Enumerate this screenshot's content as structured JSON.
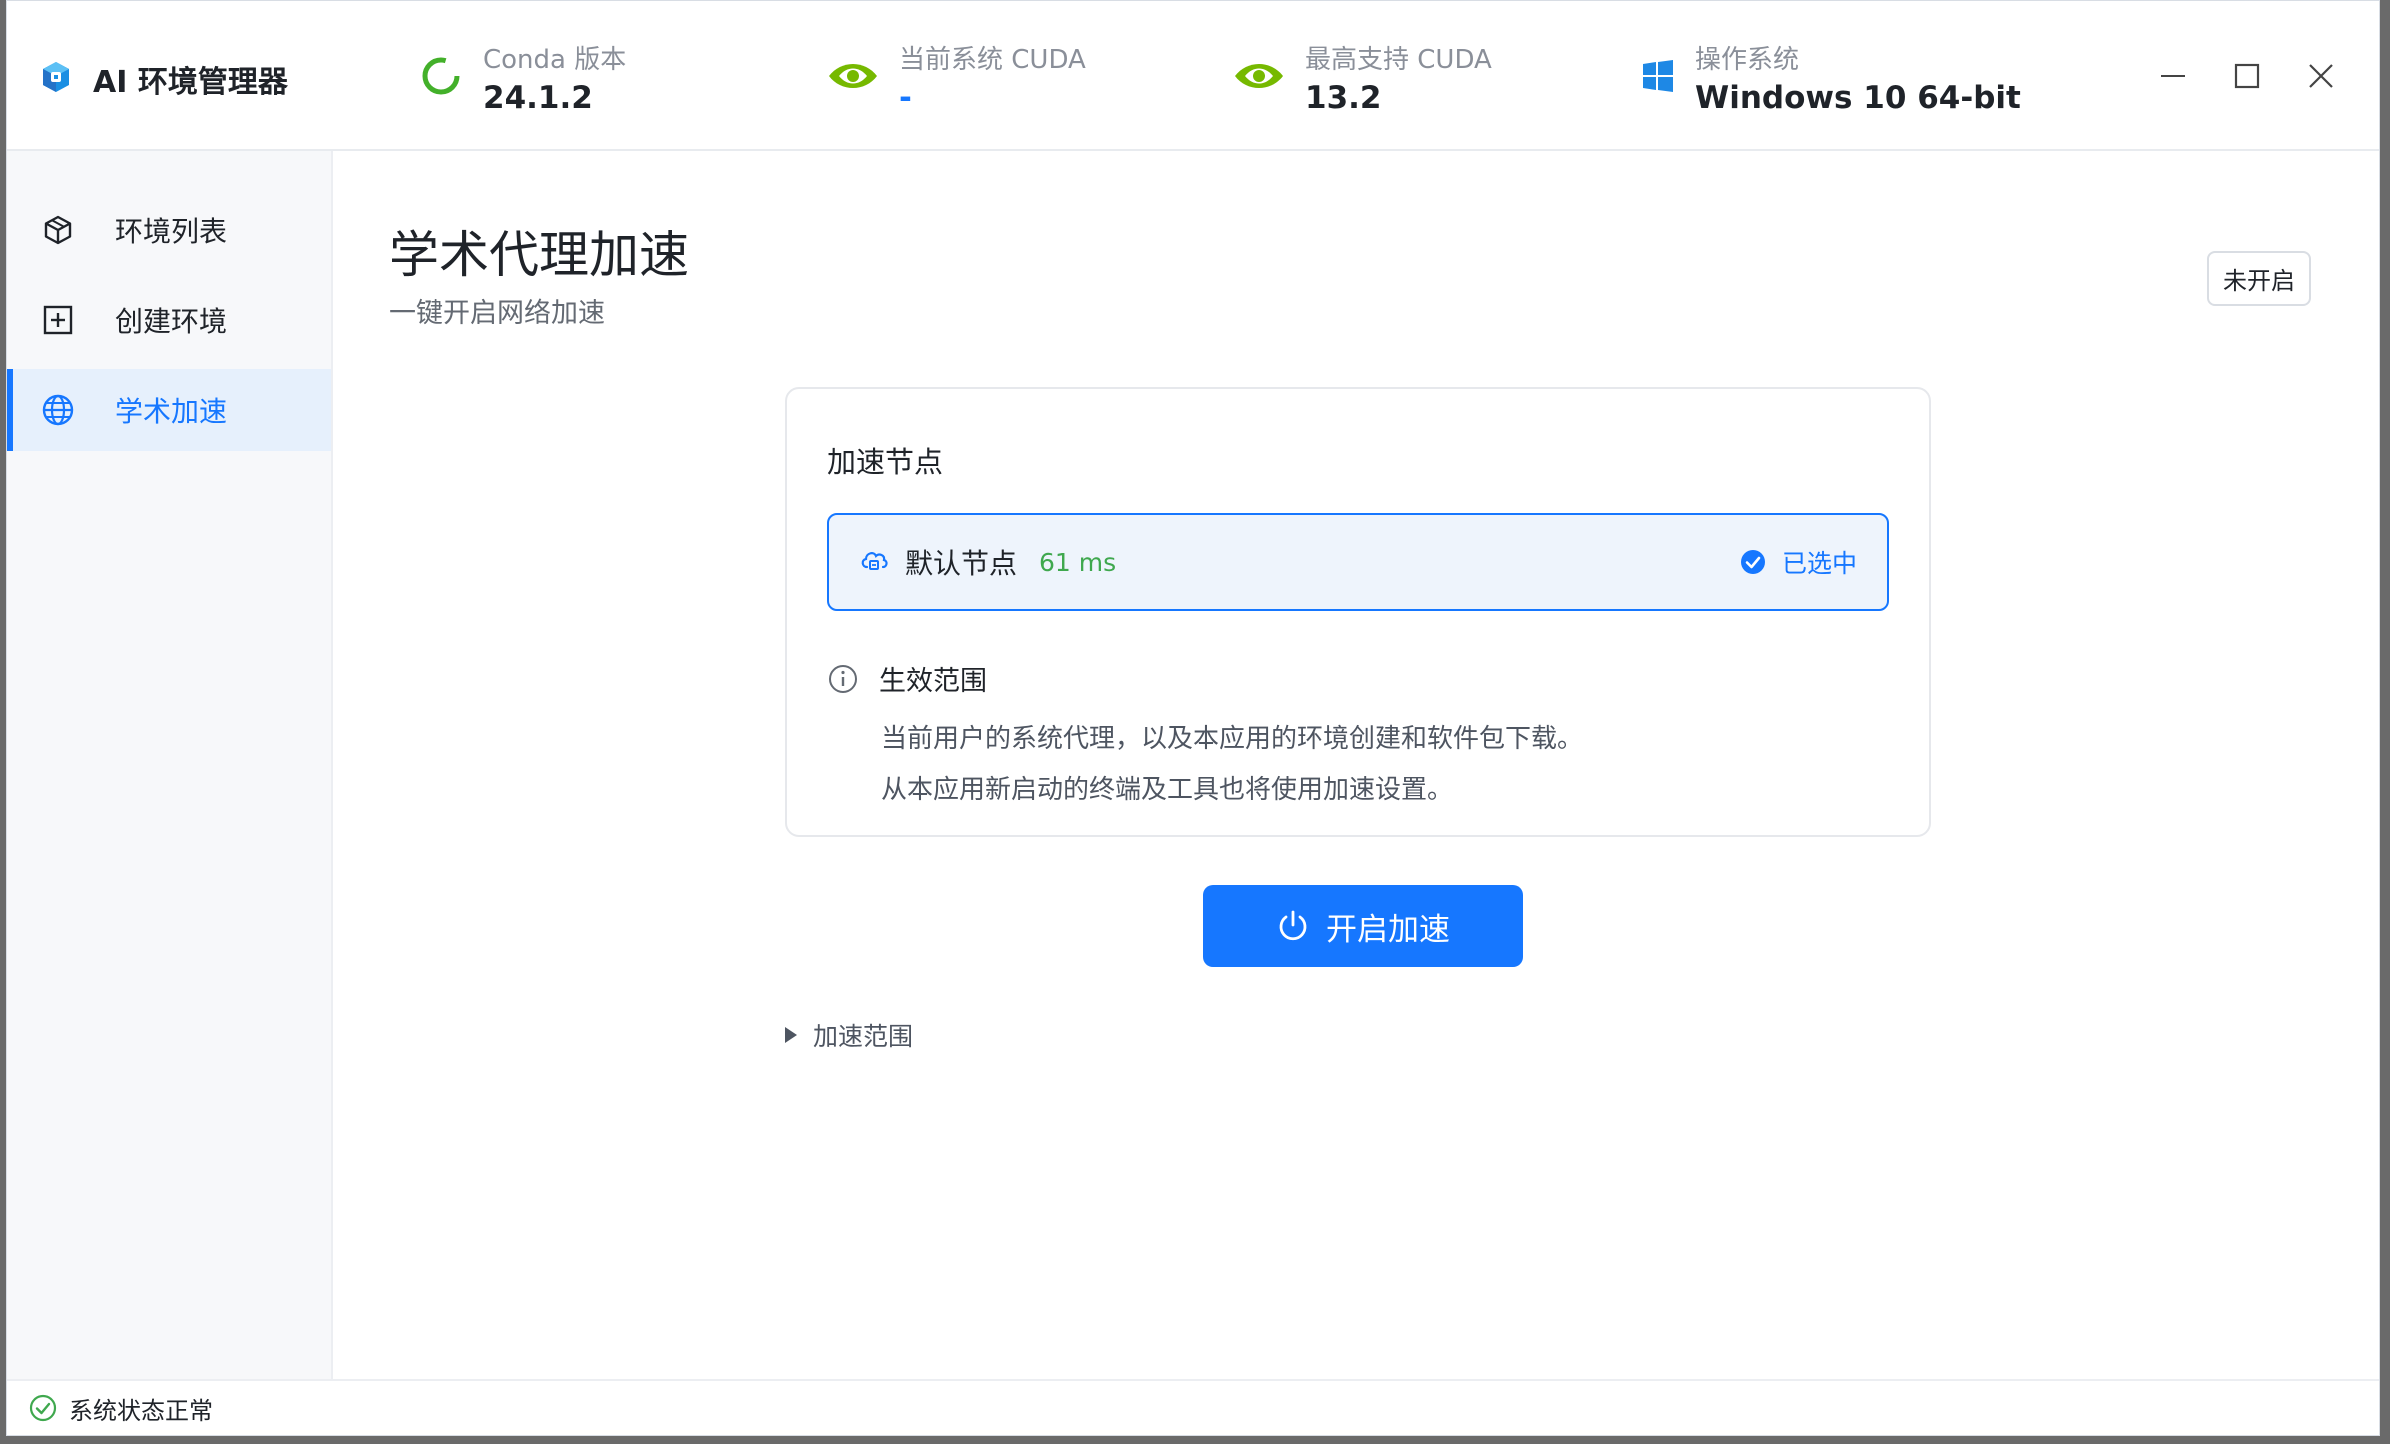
{
  "app": {
    "title": "AI 环境管理器"
  },
  "header": {
    "conda": {
      "label": "Conda 版本",
      "value": "24.1.2"
    },
    "current_cuda": {
      "label": "当前系统 CUDA",
      "value": "-"
    },
    "max_cuda": {
      "label": "最高支持 CUDA",
      "value": "13.2"
    },
    "os": {
      "label": "操作系统",
      "value": "Windows 10 64-bit"
    }
  },
  "sidebar": {
    "items": [
      {
        "label": "环境列表",
        "icon": "cube-icon",
        "active": false
      },
      {
        "label": "创建环境",
        "icon": "plus-square-icon",
        "active": false
      },
      {
        "label": "学术加速",
        "icon": "globe-icon",
        "active": true
      }
    ]
  },
  "page": {
    "title": "学术代理加速",
    "subtitle": "一键开启网络加速",
    "status_tag": "未开启"
  },
  "card": {
    "title": "加速节点",
    "node": {
      "name": "默认节点",
      "latency": "61 ms",
      "selected_label": "已选中"
    },
    "scope": {
      "title": "生效范围",
      "lines": [
        "当前用户的系统代理，以及本应用的环境创建和软件包下载。",
        "从本应用新启动的终端及工具也将使用加速设置。"
      ]
    }
  },
  "actions": {
    "start_button": "开启加速"
  },
  "expander": {
    "label": "加速范围"
  },
  "statusbar": {
    "text": "系统状态正常"
  },
  "colors": {
    "accent": "#1677ff",
    "success": "#3fa84e",
    "nvidia": "#76b900"
  }
}
